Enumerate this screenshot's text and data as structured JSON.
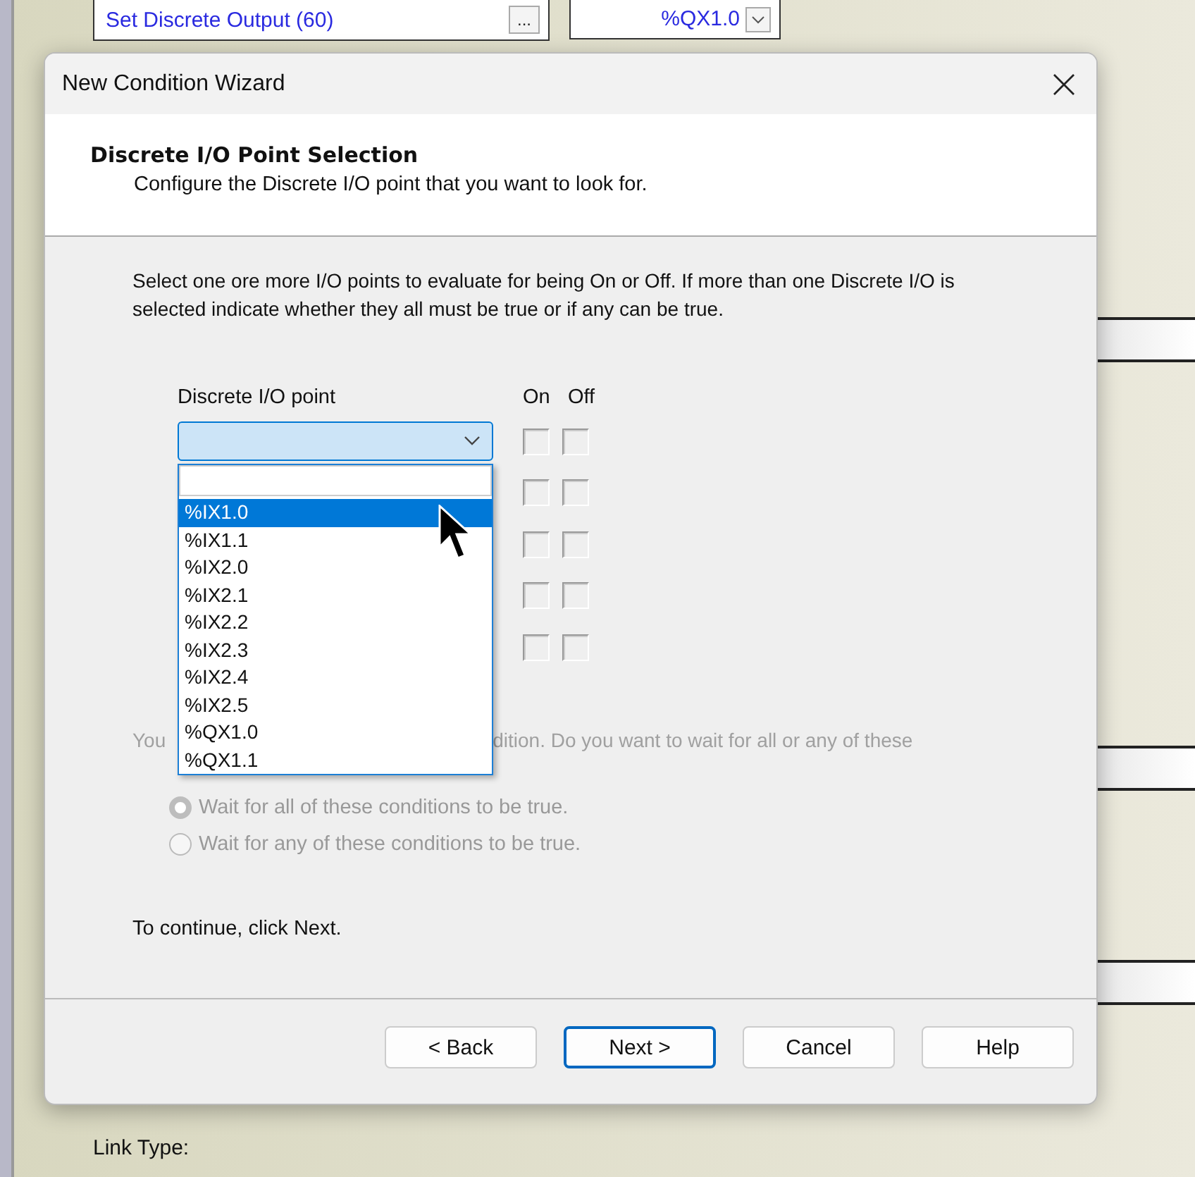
{
  "background": {
    "action_field": "Set Discrete Output (60)",
    "browse_button": "...",
    "output_combo": "%QX1.0",
    "link_type_label": "Link Type:"
  },
  "dialog": {
    "title": "New Condition Wizard",
    "header": {
      "title": "Discrete I/O Point Selection",
      "subtitle": "Configure the Discrete I/O point that you want to look for."
    },
    "instructions": "Select one ore more I/O points to evaluate for being On or Off. If more than one Discrete I/O is selected indicate whether they all must be true or if any can be true.",
    "columns": {
      "point": "Discrete I/O point",
      "on": "On",
      "off": "Off"
    },
    "rows": [
      {
        "on": false,
        "off": false
      },
      {
        "on": false,
        "off": false
      },
      {
        "on": false,
        "off": false
      },
      {
        "on": false,
        "off": false
      },
      {
        "on": false,
        "off": false
      }
    ],
    "dropdown": {
      "expanded": true,
      "items": [
        {
          "label": "%IX1.0",
          "selected": true
        },
        {
          "label": "%IX1.1",
          "selected": false
        },
        {
          "label": "%IX2.0",
          "selected": false
        },
        {
          "label": "%IX2.1",
          "selected": false
        },
        {
          "label": "%IX2.2",
          "selected": false
        },
        {
          "label": "%IX2.3",
          "selected": false
        },
        {
          "label": "%IX2.4",
          "selected": false
        },
        {
          "label": "%IX2.5",
          "selected": false
        },
        {
          "label": "%QX1.0",
          "selected": false
        },
        {
          "label": "%QX1.1",
          "selected": false
        }
      ]
    },
    "wait_text": {
      "left": "You",
      "right": "dition. Do you want to wait for all or any of these"
    },
    "radios": [
      {
        "label": "Wait for all of these conditions to be true.",
        "selected": true,
        "disabled": true
      },
      {
        "label": "Wait for any of these conditions to be true.",
        "selected": false,
        "disabled": true
      }
    ],
    "continue_text": "To continue, click Next.",
    "buttons": [
      {
        "label": "< Back",
        "default": false
      },
      {
        "label": "Next >",
        "default": true
      },
      {
        "label": "Cancel",
        "default": false
      },
      {
        "label": "Help",
        "default": false
      }
    ]
  }
}
